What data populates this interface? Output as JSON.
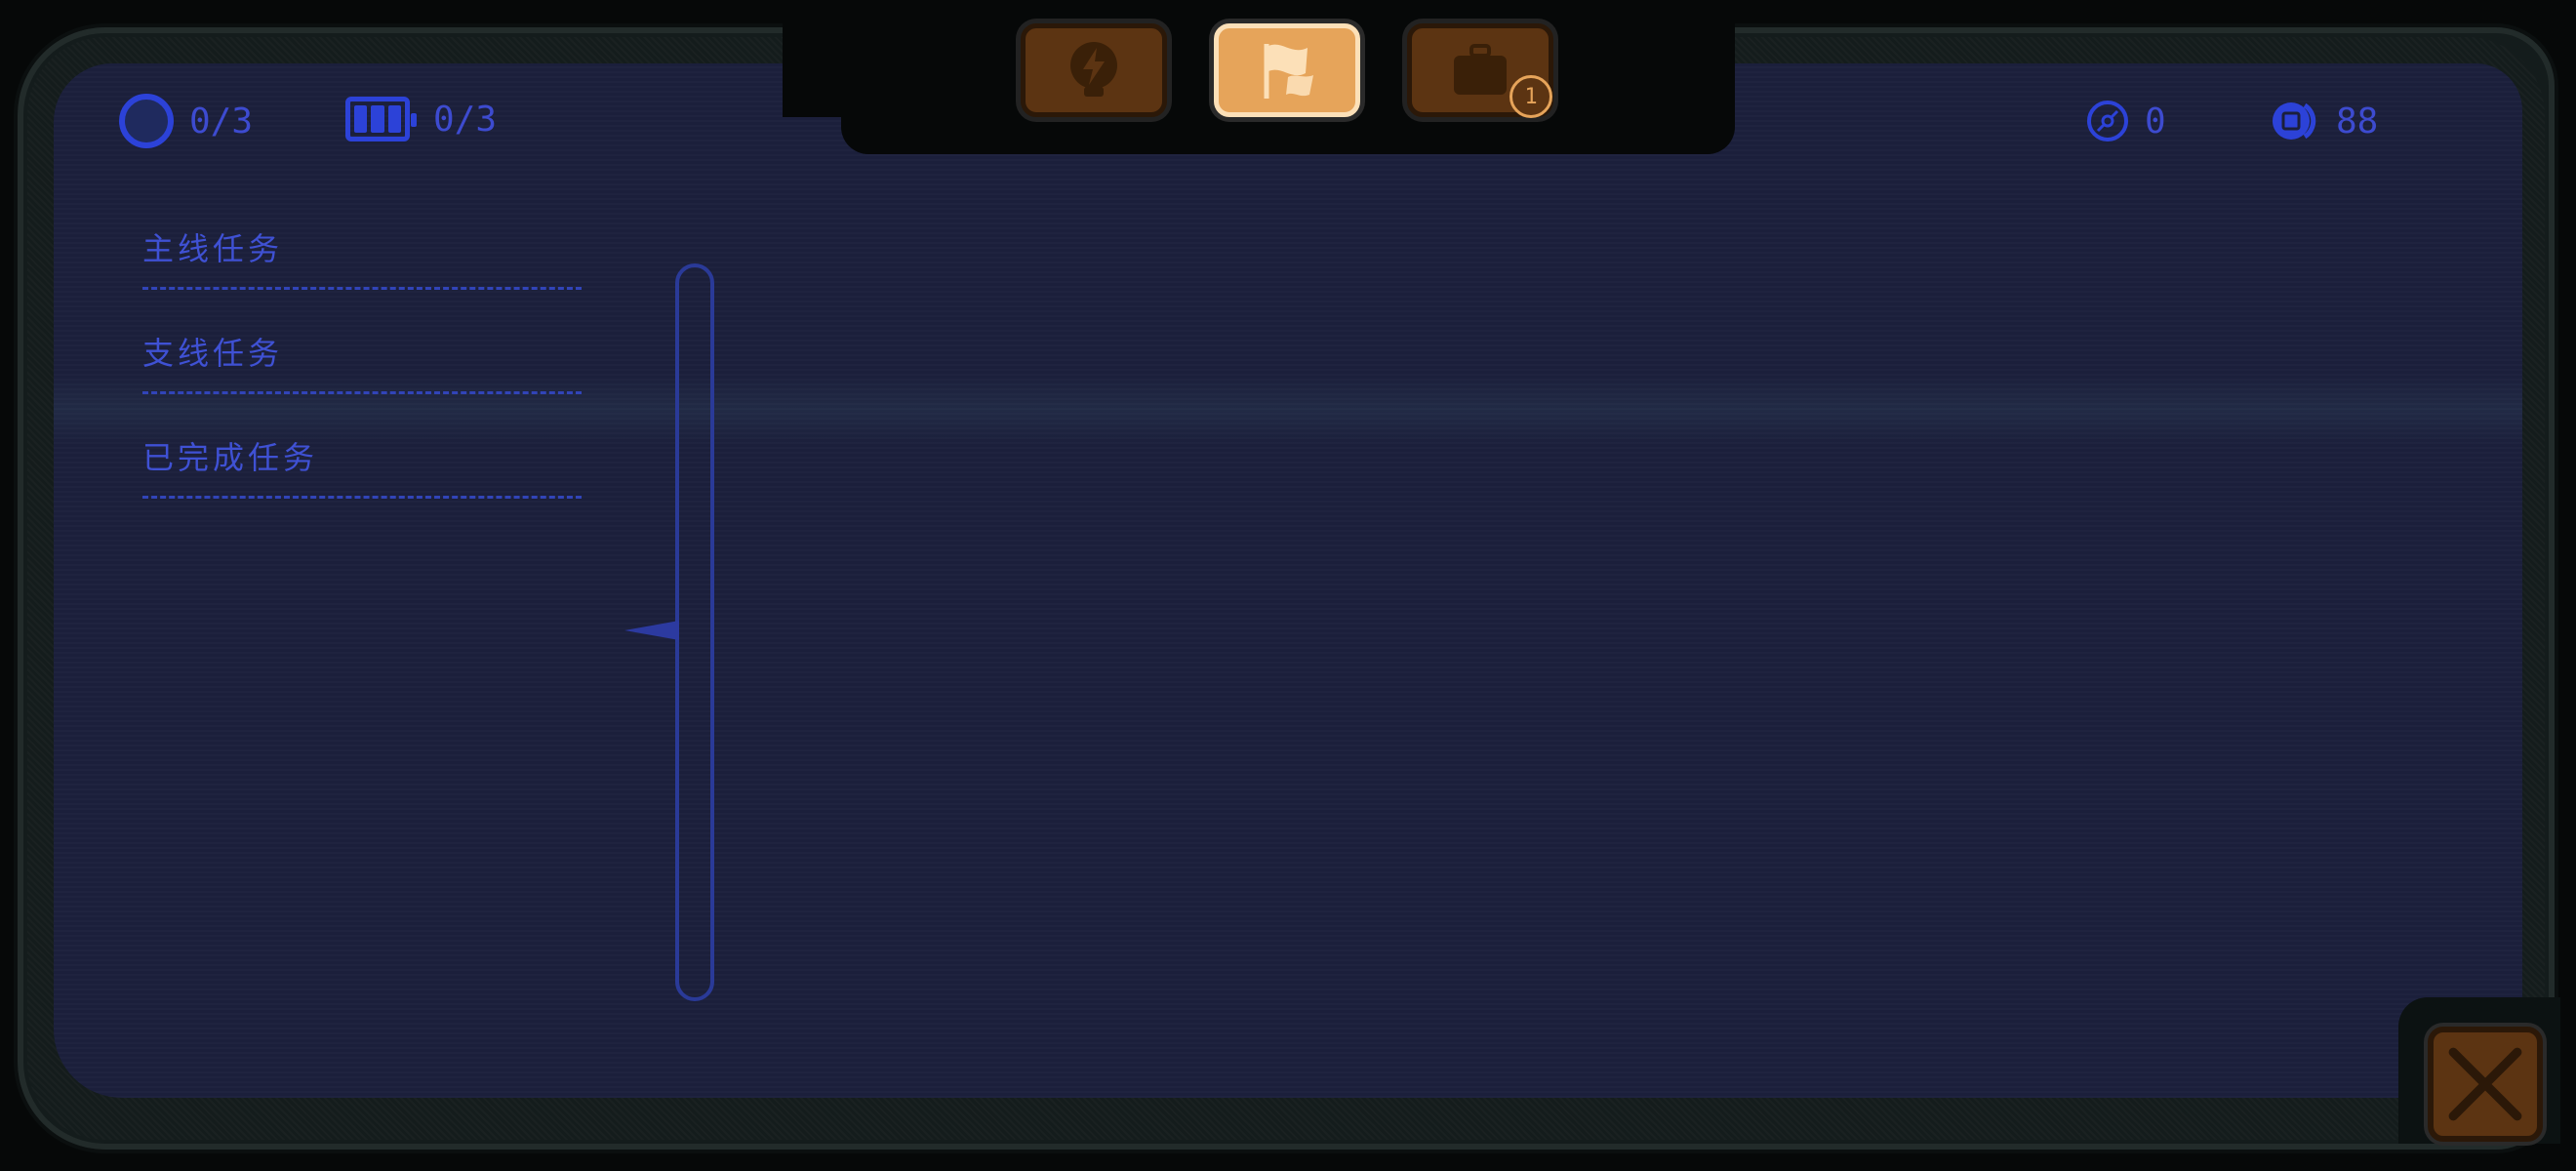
{
  "tabs": [
    {
      "name": "lightning-tab",
      "icon": "lightning-bulb-icon",
      "active": false
    },
    {
      "name": "quest-tab",
      "icon": "flag-icon",
      "active": true
    },
    {
      "name": "inventory-tab",
      "icon": "briefcase-icon",
      "active": false,
      "badge": "1"
    }
  ],
  "status": {
    "ring": {
      "icon": "ring-icon",
      "value": "0/3"
    },
    "battery": {
      "icon": "battery-icon",
      "value": "0/3"
    },
    "disc": {
      "icon": "disc-icon",
      "value": "0"
    },
    "coin": {
      "icon": "coin-icon",
      "value": "88"
    }
  },
  "quest_categories": [
    {
      "label": "主线任务"
    },
    {
      "label": "支线任务"
    },
    {
      "label": "已完成任务"
    }
  ],
  "close": {
    "icon": "close-icon"
  },
  "colors": {
    "screen": "#1b1f3b",
    "accent_blue": "#2c42d8",
    "text_blue": "#3f51d4",
    "button_brown": "#5c3412",
    "active_orange": "#e6a45a"
  }
}
